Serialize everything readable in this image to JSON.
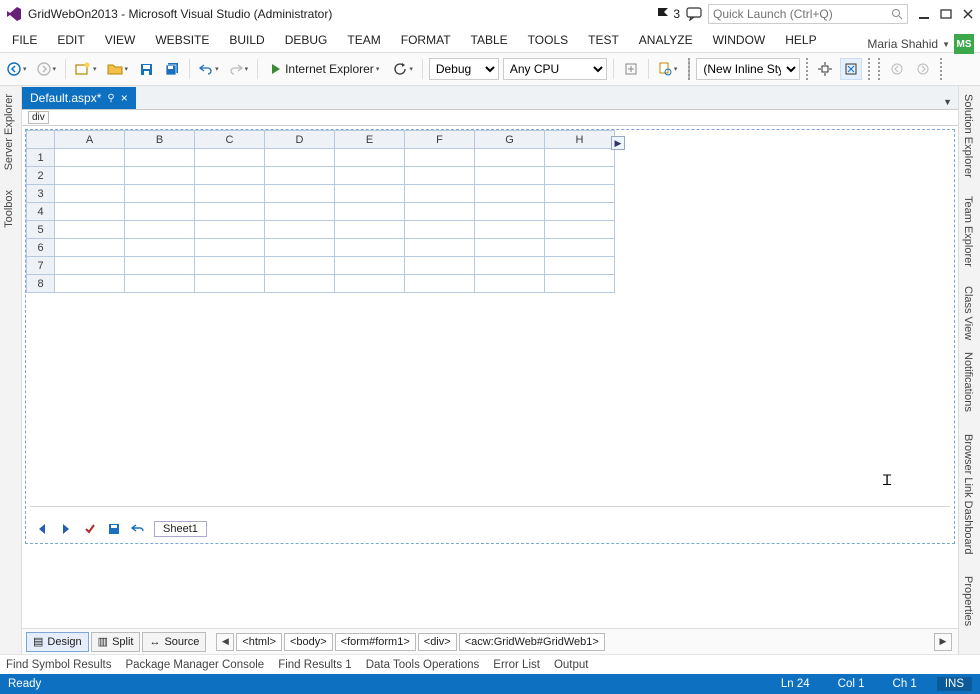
{
  "title": "GridWebOn2013 - Microsoft Visual Studio (Administrator)",
  "notif_count": "3",
  "search_placeholder": "Quick Launch (Ctrl+Q)",
  "user": {
    "name": "Maria Shahid",
    "initials": "MS"
  },
  "menus": [
    "FILE",
    "EDIT",
    "VIEW",
    "WEBSITE",
    "BUILD",
    "DEBUG",
    "TEAM",
    "FORMAT",
    "TABLE",
    "TOOLS",
    "TEST",
    "ANALYZE",
    "WINDOW",
    "HELP"
  ],
  "toolbar": {
    "browser": "Internet Explorer",
    "config": "Debug",
    "platform": "Any CPU",
    "style": "(New Inline Style"
  },
  "left_tabs": [
    "Server Explorer",
    "Toolbox"
  ],
  "right_tabs": [
    "Solution Explorer",
    "Team Explorer",
    "Class View",
    "Notifications",
    "Browser Link Dashboard",
    "Properties"
  ],
  "doc": {
    "name": "Default.aspx*"
  },
  "tag": "div",
  "columns": [
    "A",
    "B",
    "C",
    "D",
    "E",
    "F",
    "G",
    "H"
  ],
  "rows": [
    "1",
    "2",
    "3",
    "4",
    "5",
    "6",
    "7",
    "8"
  ],
  "sheet": "Sheet1",
  "views": {
    "design": "Design",
    "split": "Split",
    "source": "Source"
  },
  "breadcrumb": [
    "<html>",
    "<body>",
    "<form#form1>",
    "<div>",
    "<acw:GridWeb#GridWeb1>"
  ],
  "panels": [
    "Find Symbol Results",
    "Package Manager Console",
    "Find Results 1",
    "Data Tools Operations",
    "Error List",
    "Output"
  ],
  "status": {
    "ready": "Ready",
    "ln": "Ln 24",
    "col": "Col 1",
    "ch": "Ch 1",
    "ins": "INS"
  }
}
